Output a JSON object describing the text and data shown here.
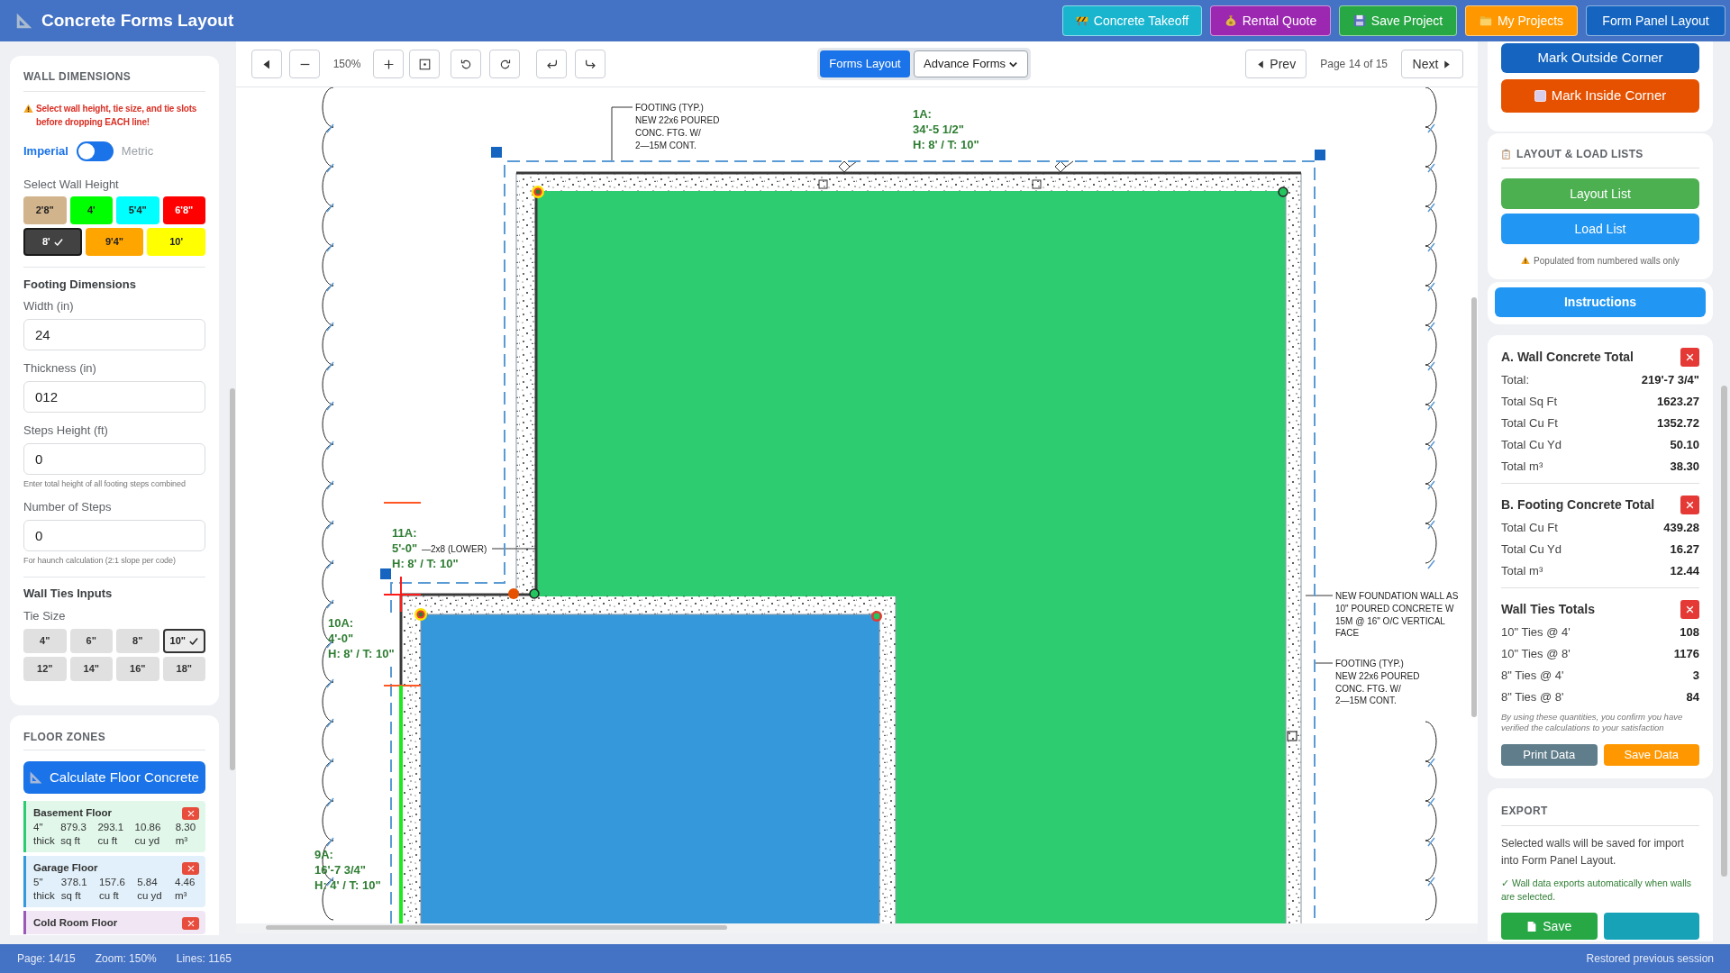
{
  "app": {
    "title": "Concrete Forms Layout"
  },
  "header_buttons": [
    {
      "label": "Concrete Takeoff",
      "kind": "takeoff"
    },
    {
      "label": "Rental Quote",
      "kind": "rental"
    },
    {
      "label": "Save Project",
      "kind": "save"
    },
    {
      "label": "My Projects",
      "kind": "projects"
    },
    {
      "label": "Form Panel Layout",
      "kind": "panel"
    }
  ],
  "toolbar": {
    "zoom": "150%",
    "modes": [
      {
        "label": "Forms Layout",
        "selected": true
      }
    ],
    "form_type": "Advance Forms",
    "prev": "Prev",
    "page": "Page 14 of 15",
    "next": "Next"
  },
  "wall_dimensions": {
    "title": "WALL DIMENSIONS",
    "warning": "Select wall height, tie size, and tie slots before dropping EACH line!",
    "units": [
      {
        "label": "Imperial",
        "selected": true
      },
      {
        "label": "Metric",
        "selected": false
      }
    ],
    "wall_height_label": "Select Wall Height",
    "wall_heights": [
      {
        "label": "2'8\"",
        "color": "#d2b48c",
        "selected": false
      },
      {
        "label": "4'",
        "color": "#00ff00",
        "selected": false
      },
      {
        "label": "5'4\"",
        "color": "#00ffff",
        "selected": false
      },
      {
        "label": "6'8\"",
        "color": "#ff0000",
        "selected": false
      },
      {
        "label": "8'",
        "color": "#424242",
        "selected": true
      },
      {
        "label": "9'4\"",
        "color": "#ffa500",
        "selected": false
      },
      {
        "label": "10'",
        "color": "#ffff00",
        "selected": false
      }
    ],
    "footing_title": "Footing Dimensions",
    "fields": [
      {
        "label": "Width (in)",
        "value": "24"
      },
      {
        "label": "Thickness (in)",
        "value": "012"
      },
      {
        "label": "Steps Height (ft)",
        "value": "0",
        "hint": "Enter total height of all footing steps combined"
      },
      {
        "label": "Number of Steps",
        "value": "0",
        "hint": "For haunch calculation (2:1 slope per code)"
      }
    ],
    "ties_title": "Wall Ties Inputs",
    "tie_size_label": "Tie Size",
    "tie_sizes": [
      {
        "label": "4\"",
        "selected": false
      },
      {
        "label": "6\"",
        "selected": false
      },
      {
        "label": "8\"",
        "selected": false
      },
      {
        "label": "10\"",
        "selected": true
      },
      {
        "label": "12\"",
        "selected": false
      },
      {
        "label": "14\"",
        "selected": false
      },
      {
        "label": "16\"",
        "selected": false
      },
      {
        "label": "18\"",
        "selected": false
      }
    ]
  },
  "floor_zones": {
    "title": "FLOOR ZONES",
    "calculate_button": "Calculate Floor Concrete",
    "zones": [
      {
        "name": "Basement Floor",
        "color": "#2ecc71",
        "stats": [
          "4\" thick",
          "879.3 sq ft",
          "293.1 cu ft",
          "10.86 cu yd",
          "8.30 m³"
        ]
      },
      {
        "name": "Garage Floor",
        "color": "#3498db",
        "stats": [
          "5\" thick",
          "378.1 sq ft",
          "157.6 cu ft",
          "5.84 cu yd",
          "4.46 m³"
        ]
      },
      {
        "name": "Cold Room Floor",
        "color": "#9b59b6"
      }
    ]
  },
  "canvas": {
    "wall_labels": [
      {
        "name": "1A:",
        "length": "34'-5 1/2\"",
        "spec": "H: 8' / T: 10\""
      },
      {
        "name": "11A:",
        "length": "5'-0\"",
        "spec": "H: 8' / T: 10\""
      },
      {
        "name": "10A:",
        "length": "4'-0\"",
        "spec": "H: 8' / T: 10\""
      },
      {
        "name": "9A:",
        "length": "16'-7 3/4\"",
        "spec": "H: 4' / T: 10\""
      }
    ],
    "notes": [
      {
        "lines": [
          "FOOTING (TYP.)",
          "NEW 22x6 POURED",
          "CONC. FTG. W/",
          "2—15M CONT."
        ]
      },
      {
        "lines": [
          "—2x8 (LOWER)"
        ]
      },
      {
        "lines": [
          "NEW FOUNDATION WALL AS",
          "10\" POURED CONCRETE W",
          "15M @ 16\" O/C VERTICAL",
          "FACE"
        ]
      },
      {
        "lines": [
          "FOOTING (TYP.)",
          "NEW 22x6 POURED",
          "CONC. FTG. W/",
          "2—15M CONT."
        ]
      }
    ]
  },
  "right_panel": {
    "corner_buttons": [
      {
        "label": "Mark Outside Corner",
        "kind": "outside"
      },
      {
        "label": "Mark Inside Corner",
        "kind": "inside"
      }
    ],
    "lists": {
      "title": "LAYOUT & LOAD LISTS",
      "buttons": [
        "Layout List",
        "Load List"
      ],
      "note": "Populated from numbered walls only"
    },
    "instructions": "Instructions",
    "totals": [
      {
        "title": "A. Wall Concrete Total",
        "rows": [
          {
            "label": "Total:",
            "value": "219'-7 3/4\""
          },
          {
            "label": "Total Sq Ft",
            "value": "1623.27"
          },
          {
            "label": "Total Cu Ft",
            "value": "1352.72"
          },
          {
            "label": "Total Cu Yd",
            "value": "50.10"
          },
          {
            "label": "Total m³",
            "value": "38.30"
          }
        ]
      },
      {
        "title": "B. Footing Concrete Total",
        "rows": [
          {
            "label": "Total Cu Ft",
            "value": "439.28"
          },
          {
            "label": "Total Cu Yd",
            "value": "16.27"
          },
          {
            "label": "Total m³",
            "value": "12.44"
          }
        ]
      },
      {
        "title": "Wall Ties Totals",
        "rows": [
          {
            "label": "10\" Ties @ 4'",
            "value": "108"
          },
          {
            "label": "10\" Ties @ 8'",
            "value": "1176"
          },
          {
            "label": "8\" Ties @ 4'",
            "value": "3"
          },
          {
            "label": "8\" Ties @ 8'",
            "value": "84"
          }
        ]
      }
    ],
    "disclaimer": "By using these quantities, you confirm you have verified the calculations to your satisfaction",
    "actions": [
      "Print Data",
      "Save Data"
    ],
    "export": {
      "title": "EXPORT",
      "text": "Selected walls will be saved for import into Form Panel Layout.",
      "status": "✓ Wall data exports automatically when walls are selected.",
      "buttons": [
        {
          "label": "Save",
          "kind": "save"
        },
        {
          "kind": "blank"
        }
      ]
    }
  },
  "status_bar": {
    "items": [
      "Page: 14/15",
      "Zoom: 150%",
      "Lines: 1165"
    ],
    "message": "Restored previous session"
  }
}
